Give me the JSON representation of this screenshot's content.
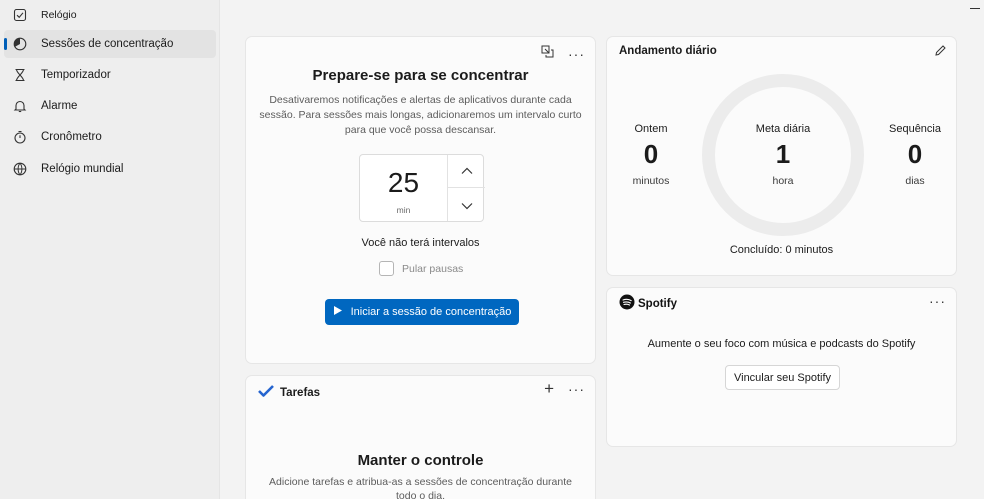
{
  "sidebar": {
    "items": [
      {
        "label": "Relógio",
        "icon": "clipboard-check-icon",
        "active": false
      },
      {
        "label": "Sessões de concentração",
        "icon": "focus-icon",
        "active": true
      },
      {
        "label": "Temporizador",
        "icon": "hourglass-icon",
        "active": false
      },
      {
        "label": "Alarme",
        "icon": "bell-icon",
        "active": false
      },
      {
        "label": "Cronômetro",
        "icon": "stopwatch-icon",
        "active": false
      },
      {
        "label": "Relógio mundial",
        "icon": "globe-icon",
        "active": false
      }
    ]
  },
  "focus": {
    "title": "Prepare-se para se concentrar",
    "description": "Desativaremos notificações e alertas de aplicativos durante cada sessão. Para sessões mais longas, adicionaremos um intervalo curto para que você possa descansar.",
    "timer_value": "25",
    "timer_unit": "min",
    "breaks_text": "Você não terá intervalos",
    "skip_breaks_label": "Pular pausas",
    "skip_breaks_checked": false,
    "start_button": "Iniciar a sessão de concentração"
  },
  "daily": {
    "title": "Andamento diário",
    "yesterday": {
      "label": "Ontem",
      "value": "0",
      "unit": "minutos"
    },
    "goal": {
      "label": "Meta diária",
      "value": "1",
      "unit": "hora"
    },
    "streak": {
      "label": "Sequência",
      "value": "0",
      "unit": "dias"
    },
    "completed": "Concluído: 0 minutos",
    "progress": 0
  },
  "spotify": {
    "brand": "Spotify",
    "text": "Aumente o seu foco com música e podcasts do Spotify",
    "link_button": "Vincular seu Spotify"
  },
  "tasks": {
    "brand": "Tarefas",
    "title": "Manter o controle",
    "description": "Adicione tarefas e atribua-as a sessões de concentração durante todo o dia."
  },
  "colors": {
    "accent": "#0067c0",
    "spotify_green": "#1db954",
    "todo_blue": "#2564cf"
  }
}
